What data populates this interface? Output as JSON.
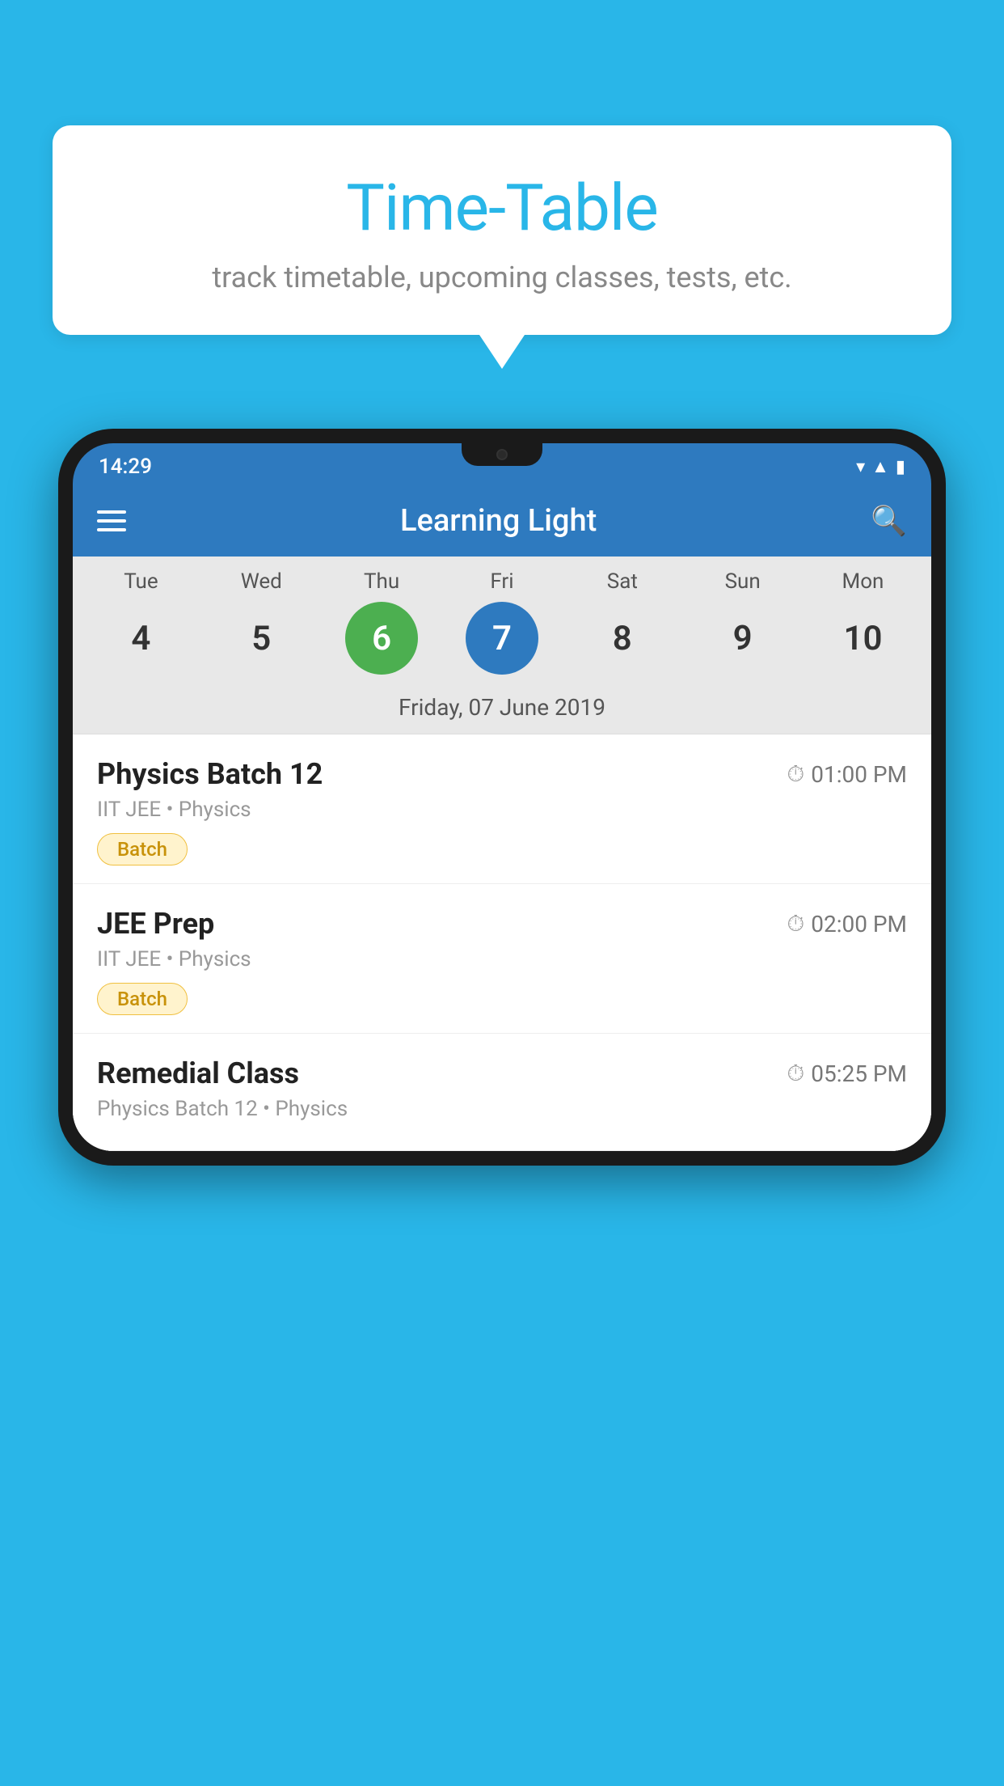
{
  "background_color": "#29b6e8",
  "speech_bubble": {
    "title": "Time-Table",
    "subtitle": "track timetable, upcoming classes, tests, etc."
  },
  "phone": {
    "status_bar": {
      "time": "14:29"
    },
    "app_header": {
      "title": "Learning Light"
    },
    "calendar": {
      "days": [
        {
          "label": "Tue",
          "number": "4",
          "state": "normal"
        },
        {
          "label": "Wed",
          "number": "5",
          "state": "normal"
        },
        {
          "label": "Thu",
          "number": "6",
          "state": "today"
        },
        {
          "label": "Fri",
          "number": "7",
          "state": "selected"
        },
        {
          "label": "Sat",
          "number": "8",
          "state": "normal"
        },
        {
          "label": "Sun",
          "number": "9",
          "state": "normal"
        },
        {
          "label": "Mon",
          "number": "10",
          "state": "normal"
        }
      ],
      "selected_date_label": "Friday, 07 June 2019"
    },
    "schedule": [
      {
        "title": "Physics Batch 12",
        "time": "01:00 PM",
        "subtitle": "IIT JEE • Physics",
        "badge": "Batch"
      },
      {
        "title": "JEE Prep",
        "time": "02:00 PM",
        "subtitle": "IIT JEE • Physics",
        "badge": "Batch"
      },
      {
        "title": "Remedial Class",
        "time": "05:25 PM",
        "subtitle": "Physics Batch 12 • Physics",
        "badge": null
      }
    ]
  }
}
